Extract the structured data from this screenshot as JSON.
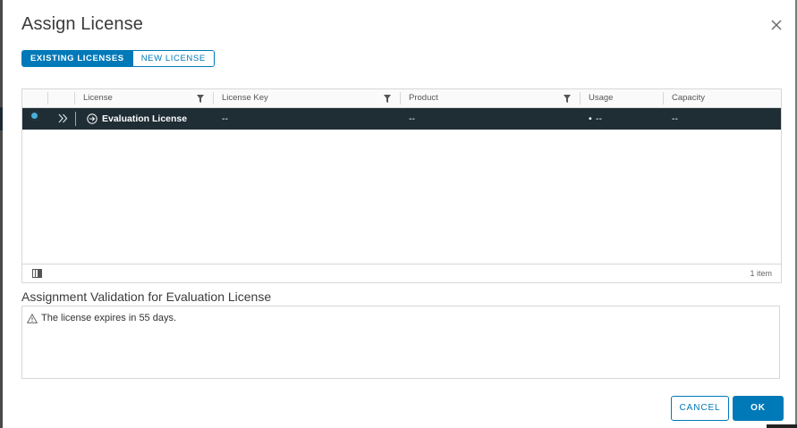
{
  "dialog": {
    "title": "Assign License"
  },
  "tabs": {
    "existing_label": "EXISTING LICENSES",
    "new_label": "NEW LICENSE",
    "active": "existing"
  },
  "grid": {
    "columns": [
      "License",
      "License Key",
      "Product",
      "Usage",
      "Capacity"
    ],
    "rows": [
      {
        "selected": true,
        "license": "Evaluation License",
        "license_key": "--",
        "product": "--",
        "usage_bullet": "•",
        "usage": "--",
        "capacity": "--"
      }
    ],
    "item_count": "1 item"
  },
  "validation": {
    "title": "Assignment Validation for Evaluation License",
    "message": "The license expires in 55 days."
  },
  "buttons": {
    "cancel": "CANCEL",
    "ok": "OK"
  },
  "colors": {
    "primary": "#0079b8",
    "selected_row": "#1f2d35",
    "radio_accent": "#49afd9"
  },
  "icons": {
    "close": "close-icon",
    "filter": "filter-icon",
    "expand": "double-chevron-right-icon",
    "license": "circle-arrow-right-icon",
    "column_toggle": "column-toggle-icon",
    "warning": "warning-triangle-icon"
  }
}
